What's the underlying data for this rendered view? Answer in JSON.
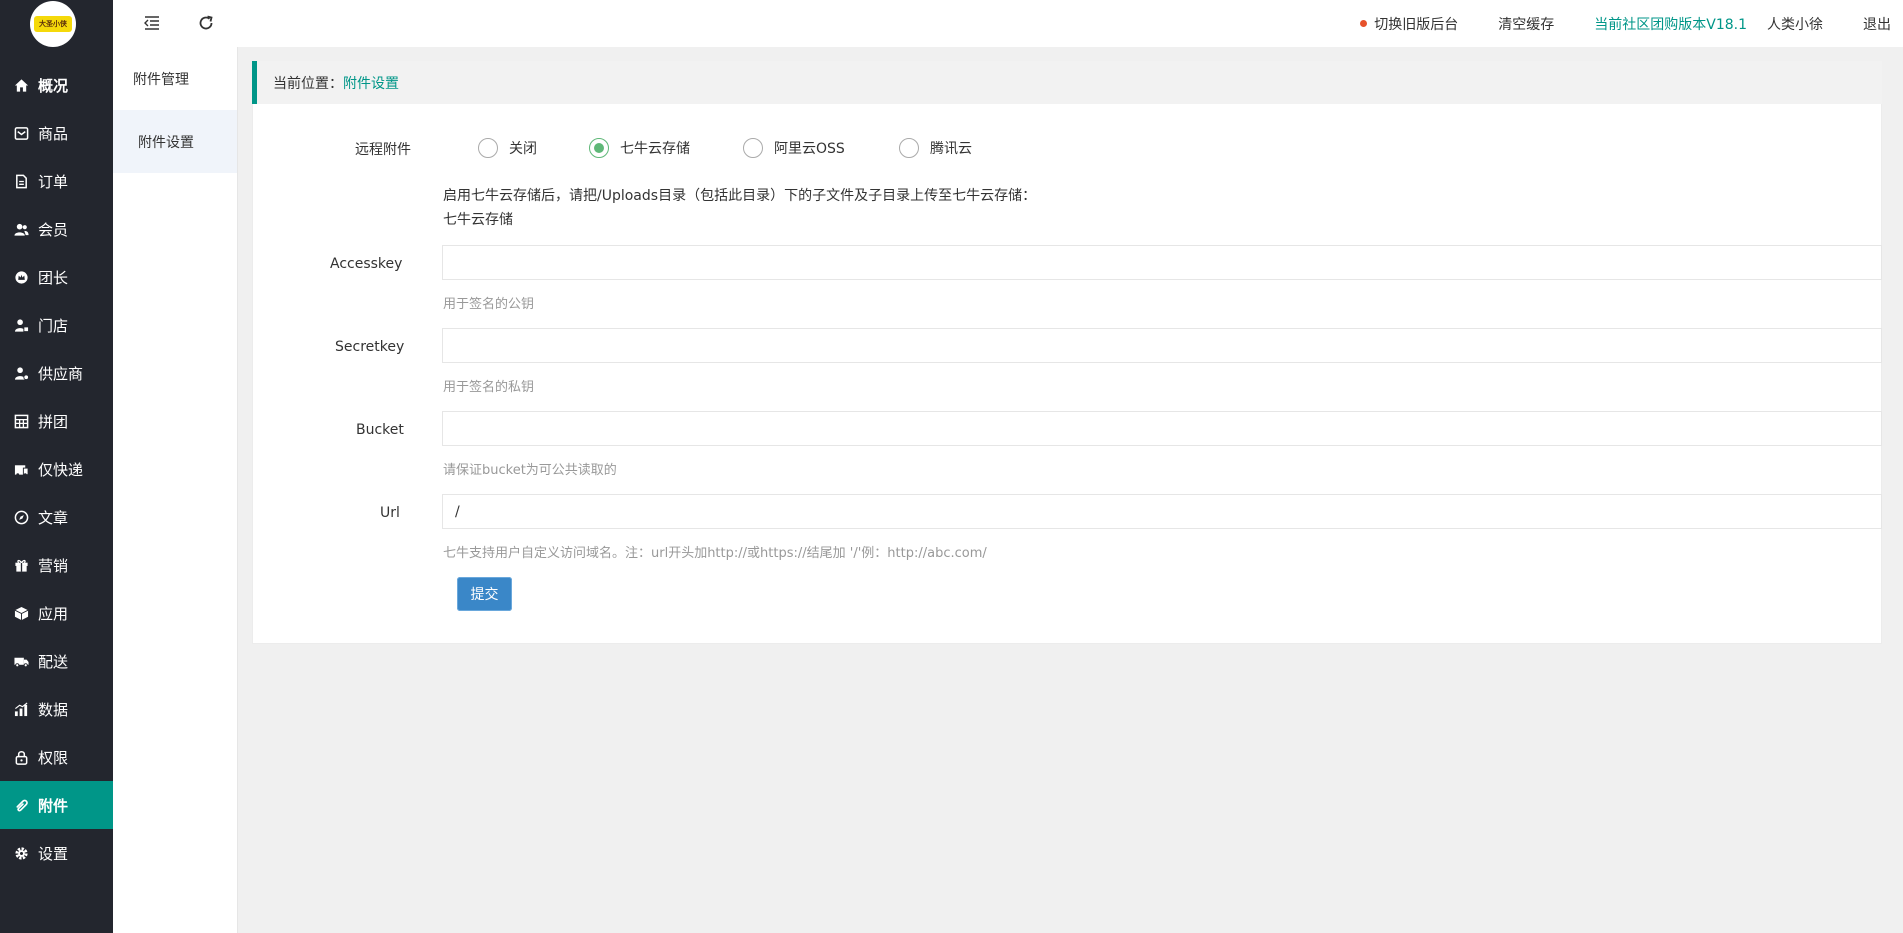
{
  "logo": {
    "text": "大圣小侠"
  },
  "sidebar": {
    "items": [
      {
        "label": "概况",
        "icon": "home-icon"
      },
      {
        "label": "商品",
        "icon": "goods-icon"
      },
      {
        "label": "订单",
        "icon": "order-icon"
      },
      {
        "label": "会员",
        "icon": "member-icon"
      },
      {
        "label": "团长",
        "icon": "leader-icon"
      },
      {
        "label": "门店",
        "icon": "store-icon"
      },
      {
        "label": "供应商",
        "icon": "supplier-icon"
      },
      {
        "label": "拼团",
        "icon": "group-icon"
      },
      {
        "label": "仅快递",
        "icon": "express-icon"
      },
      {
        "label": "文章",
        "icon": "article-icon"
      },
      {
        "label": "营销",
        "icon": "gift-icon"
      },
      {
        "label": "应用",
        "icon": "app-icon"
      },
      {
        "label": "配送",
        "icon": "truck-icon"
      },
      {
        "label": "数据",
        "icon": "chart-icon"
      },
      {
        "label": "权限",
        "icon": "lock-icon"
      },
      {
        "label": "附件",
        "icon": "attachment-icon"
      },
      {
        "label": "设置",
        "icon": "gear-icon"
      }
    ],
    "active": "附件"
  },
  "subnav": {
    "items": [
      {
        "label": "附件管理"
      },
      {
        "label": "附件设置"
      }
    ]
  },
  "header": {
    "switch_old": "切换旧版后台",
    "clear_cache": "清空缓存",
    "version": "当前社区团购版本V18.1",
    "user": "人类小徐",
    "logout": "退出"
  },
  "breadcrumb": {
    "prefix": "当前位置：",
    "current": "附件设置"
  },
  "form": {
    "remote_label": "远程附件",
    "remote_options": [
      "关闭",
      "七牛云存储",
      "阿里云OSS",
      "腾讯云"
    ],
    "remote_selected": "七牛云存储",
    "notice_line1": "启用七牛云存储后，请把/Uploads目录（包括此目录）下的子文件及子目录上传至七牛云存储：",
    "notice_line2": "七牛云存储",
    "accesskey_label": "Accesskey",
    "accesskey_value": "",
    "accesskey_help": "用于签名的公钥",
    "secretkey_label": "Secretkey",
    "secretkey_value": "",
    "secretkey_help": "用于签名的私钥",
    "bucket_label": "Bucket",
    "bucket_value": "",
    "bucket_help": "请保证bucket为可公共读取的",
    "url_label": "Url",
    "url_value": "/",
    "url_help": "七牛支持用户自定义访问域名。注：url开头加http://或https://结尾加 '/'例：http://abc.com/",
    "submit_label": "提交"
  },
  "colors": {
    "accent": "#009688",
    "sidebar_bg": "#23262e",
    "radio_checked": "#5fb878",
    "submit_bg": "#3a87c8",
    "status_dot": "#e6512b"
  }
}
